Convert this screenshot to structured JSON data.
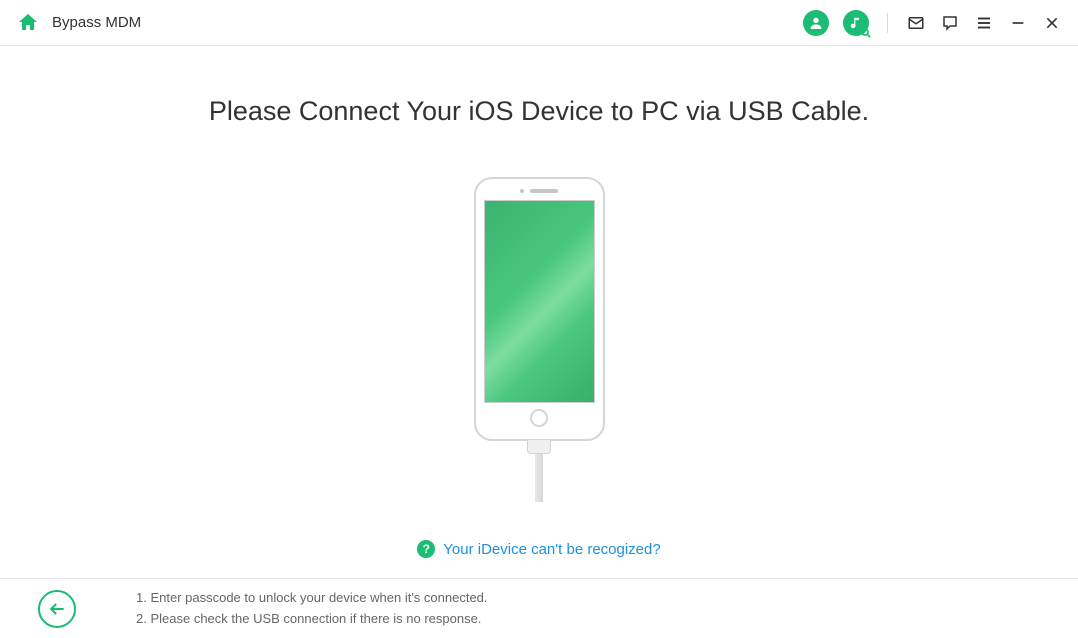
{
  "header": {
    "title": "Bypass MDM"
  },
  "main": {
    "heading": "Please Connect Your iOS Device to PC via USB Cable.",
    "help_link": "Your iDevice can't be recogized?"
  },
  "footer": {
    "step1": "1. Enter passcode to unlock your device when it's connected.",
    "step2": "2. Please check the USB connection if there is no response."
  }
}
